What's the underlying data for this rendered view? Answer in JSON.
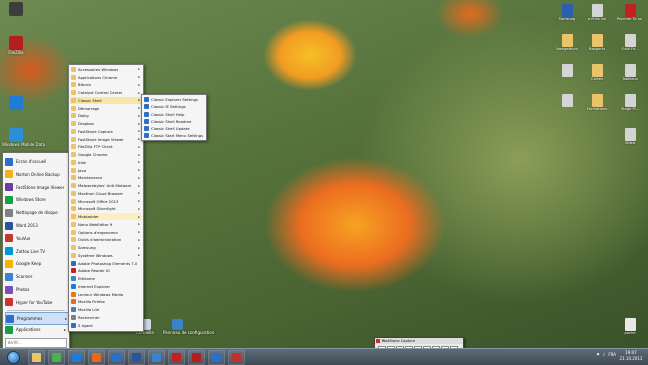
{
  "desktop": {
    "left_icons": [
      {
        "label": "",
        "color": "#3d3d3d"
      },
      {
        "label": "FileZilla",
        "color": "#b51e1e"
      },
      {
        "label": "",
        "color": "#1e7bd6"
      },
      {
        "label": "Windows Mobile Data",
        "color": "#2b8fd8"
      }
    ],
    "right_icons": [
      {
        "label": "Samsung",
        "color": "#2d5fb0"
      },
      {
        "label": "e-Frais vol",
        "color": "#d4d4d4"
      },
      {
        "label": "Pepinier Ta ou Fa...",
        "color": "#c42020"
      },
      {
        "label": "Navigateurs",
        "color": "#e9c46a"
      },
      {
        "label": "Rapports",
        "color": "#e9c46a"
      },
      {
        "label": "Suivi Fo...",
        "color": "#d4d4d4"
      },
      {
        "label": "",
        "color": "#d4d4d4"
      },
      {
        "label": "Cartes",
        "color": "#e9c46a"
      },
      {
        "label": "Tableaux",
        "color": "#d4d4d4"
      },
      {
        "label": "",
        "color": "#d4d4d4"
      },
      {
        "label": "Formations",
        "color": "#e9c46a"
      },
      {
        "label": "Stage Pl...",
        "color": "#d4d4d4"
      },
      {
        "label": "Video",
        "color": "#d4d4d4"
      },
      {
        "label": "poche",
        "color": "#e8e8e8"
      }
    ],
    "bottom_icons": [
      {
        "label": "Corbeille",
        "color": "#cfd8e6"
      },
      {
        "label": "Panneau de configuration",
        "color": "#3a83c8"
      }
    ]
  },
  "start_menu": {
    "items": [
      {
        "label": "Ecran d'accueil",
        "color": "#2b6fc6"
      },
      {
        "label": "Norton Online Backup",
        "color": "#f3b21b"
      },
      {
        "label": "FastStone Image Viewer",
        "color": "#6a3fa0"
      },
      {
        "label": "Windows Store",
        "color": "#16a046"
      },
      {
        "label": "Nettoyage de disque",
        "color": "#808080"
      },
      {
        "label": "Word 2013",
        "color": "#2a5699"
      },
      {
        "label": "YouVue",
        "color": "#c0392b"
      },
      {
        "label": "Zattoo Live TV",
        "color": "#0098d4"
      },
      {
        "label": "Google Keep",
        "color": "#f4b400"
      },
      {
        "label": "Scanner",
        "color": "#3a83c8"
      },
      {
        "label": "Photos",
        "color": "#7b4fb7"
      },
      {
        "label": "Hyper for YouTube",
        "color": "#d03030"
      }
    ],
    "programs_label": "Programmes",
    "applications_label": "Applications",
    "search_placeholder": "Arrêt..."
  },
  "programs_menu": {
    "items": [
      {
        "label": "Accessoires Windows",
        "color": "#e9c46a",
        "arrow": true
      },
      {
        "label": "Applications Chrome",
        "color": "#e9c46a",
        "arrow": true
      },
      {
        "label": "Bitcoin",
        "color": "#e9c46a",
        "arrow": true
      },
      {
        "label": "Catalyst Control Center",
        "color": "#e9c46a",
        "arrow": true
      },
      {
        "label": "Classic Shell",
        "color": "#e9c46a",
        "arrow": true
      },
      {
        "label": "Démarrage",
        "color": "#e9c46a",
        "arrow": true
      },
      {
        "label": "Dolby",
        "color": "#e9c46a",
        "arrow": true
      },
      {
        "label": "Dropbox",
        "color": "#e9c46a",
        "arrow": true
      },
      {
        "label": "FastStone Capture",
        "color": "#e9c46a",
        "arrow": true
      },
      {
        "label": "FastStone Image Viewer",
        "color": "#e9c46a",
        "arrow": true
      },
      {
        "label": "FileZilla FTP Client",
        "color": "#e9c46a",
        "arrow": true
      },
      {
        "label": "Google Chrome",
        "color": "#e9c46a",
        "arrow": true
      },
      {
        "label": "Intel",
        "color": "#e9c46a",
        "arrow": true
      },
      {
        "label": "Java",
        "color": "#e9c46a",
        "arrow": true
      },
      {
        "label": "Maintenance",
        "color": "#e9c46a",
        "arrow": true
      },
      {
        "label": "Malwarebytes' Anti-Malware",
        "color": "#e9c46a",
        "arrow": true
      },
      {
        "label": "Maxthon Cloud Browser",
        "color": "#e9c46a",
        "arrow": true
      },
      {
        "label": "Microsoft Office 2013",
        "color": "#e9c46a",
        "arrow": true
      },
      {
        "label": "Microsoft Silverlight",
        "color": "#e9c46a",
        "arrow": true
      },
      {
        "label": "Mobizoider",
        "color": "#e9c46a",
        "arrow": true
      },
      {
        "label": "Nano WebEditor 9",
        "color": "#e9c46a",
        "arrow": true
      },
      {
        "label": "Options d'ergonomie",
        "color": "#e9c46a",
        "arrow": true
      },
      {
        "label": "Outils d'administration",
        "color": "#e9c46a",
        "arrow": true
      },
      {
        "label": "Samsung",
        "color": "#e9c46a",
        "arrow": true
      },
      {
        "label": "Système Windows",
        "color": "#e9c46a",
        "arrow": true
      },
      {
        "label": "Adobe Photoshop Elements 7.0",
        "color": "#2a6cc4",
        "arrow": false
      },
      {
        "label": "Adobe Reader XI",
        "color": "#c42020",
        "arrow": false
      },
      {
        "label": "Ettikome",
        "color": "#3a83c8",
        "arrow": false
      },
      {
        "label": "Internet Explorer",
        "color": "#1e7bd6",
        "arrow": false
      },
      {
        "label": "Lecteur Windows Media",
        "color": "#e07b1a",
        "arrow": false
      },
      {
        "label": "Mozilla Firefox",
        "color": "#e66a1b",
        "arrow": false
      },
      {
        "label": "Mozilla Lite",
        "color": "#3a83c8",
        "arrow": false
      },
      {
        "label": "Rechercher",
        "color": "#808080",
        "arrow": false
      },
      {
        "label": "S Agent",
        "color": "#2b6fc6",
        "arrow": false
      }
    ],
    "highlight_color": "#f7e7a5"
  },
  "classic_menu": {
    "items": [
      {
        "label": "Classic Explorer Settings"
      },
      {
        "label": "Classic IE Settings"
      },
      {
        "label": "Classic Shell Help"
      },
      {
        "label": "Classic Shell Readme"
      },
      {
        "label": "Classic Shell Update"
      },
      {
        "label": "Classic Start Menu Settings"
      }
    ]
  },
  "capture_window": {
    "title": "FastStone Capture",
    "close_glyph": "✕"
  },
  "taskbar": {
    "apps": [
      {
        "label": "explorer",
        "color": "#e9c46a"
      },
      {
        "label": "chrome",
        "color": "#4caf50"
      },
      {
        "label": "ie",
        "color": "#1e7bd6"
      },
      {
        "label": "firefox",
        "color": "#e66a1b"
      },
      {
        "label": "media",
        "color": "#2b6fc6"
      },
      {
        "label": "word",
        "color": "#2a5699"
      },
      {
        "label": "store",
        "color": "#3a83c8"
      },
      {
        "label": "acrobat",
        "color": "#c42020"
      },
      {
        "label": "filezilla",
        "color": "#b51e1e"
      },
      {
        "label": "mail",
        "color": "#2b6fc6"
      },
      {
        "label": "faststone",
        "color": "#c82e2e"
      }
    ],
    "language": "FRA",
    "time": "19:47",
    "date": "21.10.2013"
  }
}
